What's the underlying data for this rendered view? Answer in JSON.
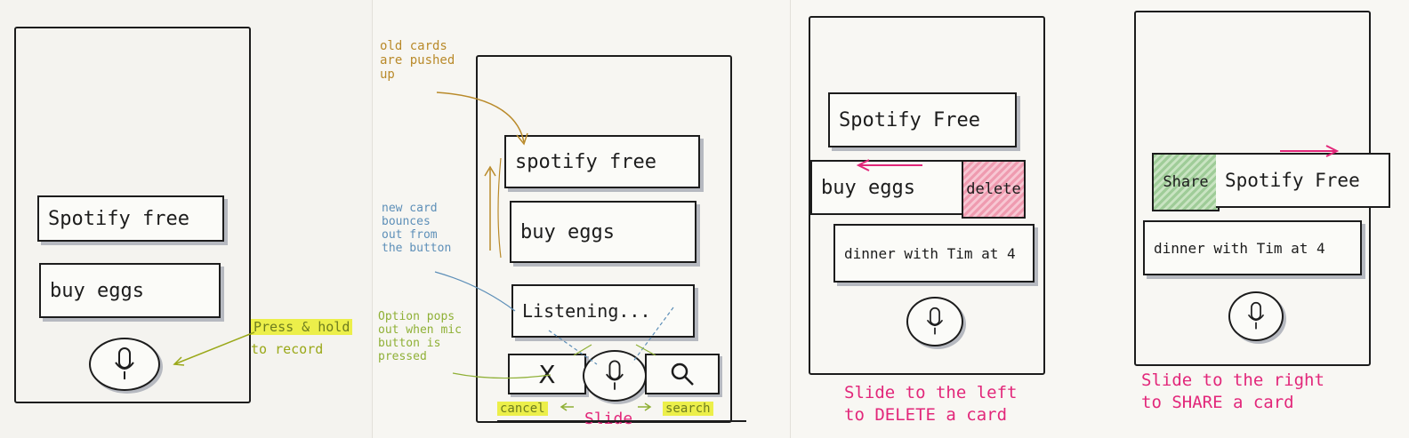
{
  "sketch1": {
    "cards": [
      "Spotify free",
      "buy eggs"
    ],
    "note_line1": "Press & hold",
    "note_line2": "to record"
  },
  "sketch2": {
    "note_old": "old cards are pushed up",
    "note_new": "new card bounces out from the button",
    "note_option": "Option pops out when mic button is pressed",
    "cards": [
      "spotify free",
      "buy eggs",
      "Listening..."
    ],
    "cancel_icon": "X",
    "label_cancel": "cancel",
    "label_slide": "Slide",
    "label_search": "search"
  },
  "sketch3": {
    "cards": [
      "Spotify Free",
      "buy eggs",
      "dinner with Tim at 4"
    ],
    "delete_label": "delete",
    "caption_line1": "Slide to the left",
    "caption_line2": "to DELETE a card"
  },
  "sketch4": {
    "share_label": "Share",
    "cards": [
      "Spotify Free",
      "dinner with Tim at 4"
    ],
    "caption_line1": "Slide to the right",
    "caption_line2": "to SHARE a card"
  },
  "icons": {
    "mic": "microphone-icon",
    "search": "magnifier-icon",
    "cancel": "close-icon",
    "arrow": "arrow-icon"
  },
  "colors": {
    "ink": "#1c1c1c",
    "highlight": "#ecef4a",
    "annotation_pink": "#e2277a",
    "annotation_blue": "#5d8fb8",
    "annotation_orange": "#b98a2a",
    "delete_red": "#ef9bb0",
    "share_green": "#9fcc98"
  }
}
